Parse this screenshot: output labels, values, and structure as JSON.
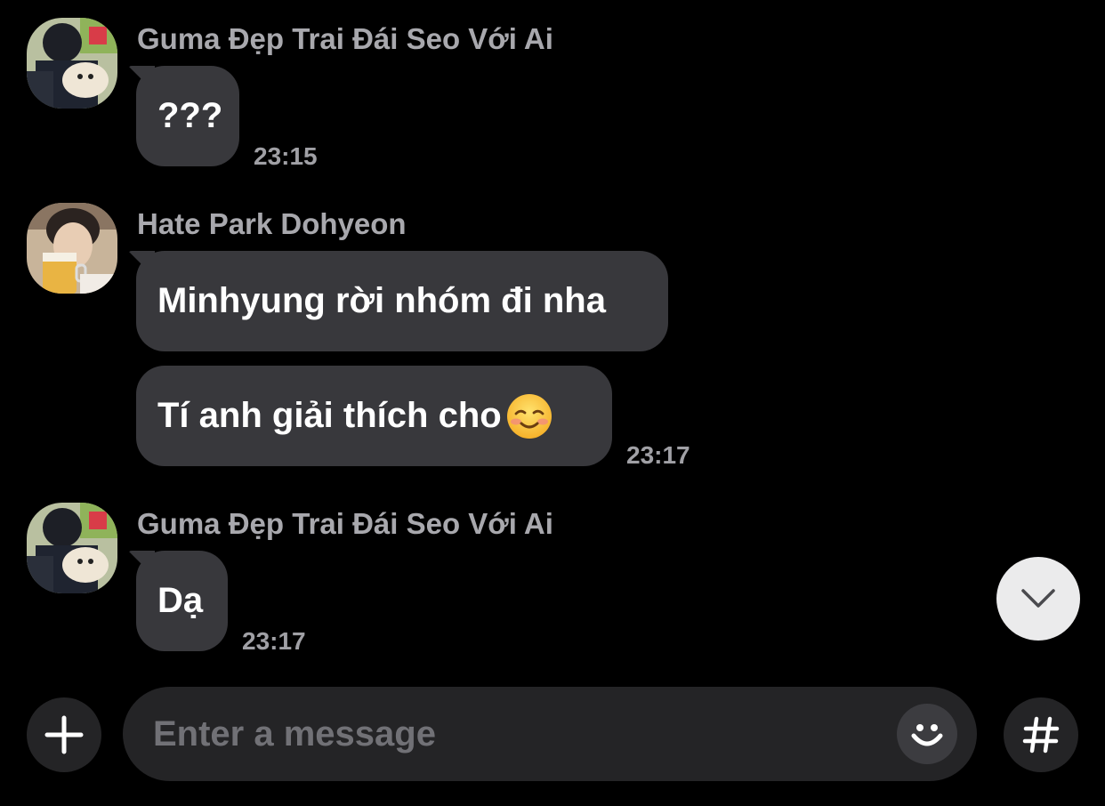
{
  "messages": [
    {
      "sender": "Guma Đẹp Trai Đái Seo Với Ai",
      "avatar_icon": "avatar-user-with-dog",
      "bubbles": [
        {
          "text": "???"
        }
      ],
      "time": "23:15"
    },
    {
      "sender": "Hate Park Dohyeon",
      "avatar_icon": "avatar-user-with-beer",
      "bubbles": [
        {
          "text": "Minhyung rời nhóm đi nha"
        },
        {
          "text": "Tí anh giải thích cho",
          "emoji": "smiling-face-emoji"
        }
      ],
      "time": "23:17"
    },
    {
      "sender": "Guma Đẹp Trai Đái Seo Với Ai",
      "avatar_icon": "avatar-user-with-dog",
      "bubbles": [
        {
          "text": "Dạ"
        }
      ],
      "time": "23:17"
    }
  ],
  "composer": {
    "placeholder": "Enter a message",
    "value": "",
    "attach_icon": "plus-icon",
    "emoji_icon": "smiley-icon",
    "hashtag_icon": "hashtag-icon"
  },
  "scroll_button_icon": "chevron-down-icon",
  "colors": {
    "background": "#000000",
    "bubble": "#38383c",
    "sender_text": "#a8a8ad",
    "timestamp": "#a0a0a5",
    "composer": "#242426",
    "placeholder": "#717176"
  }
}
